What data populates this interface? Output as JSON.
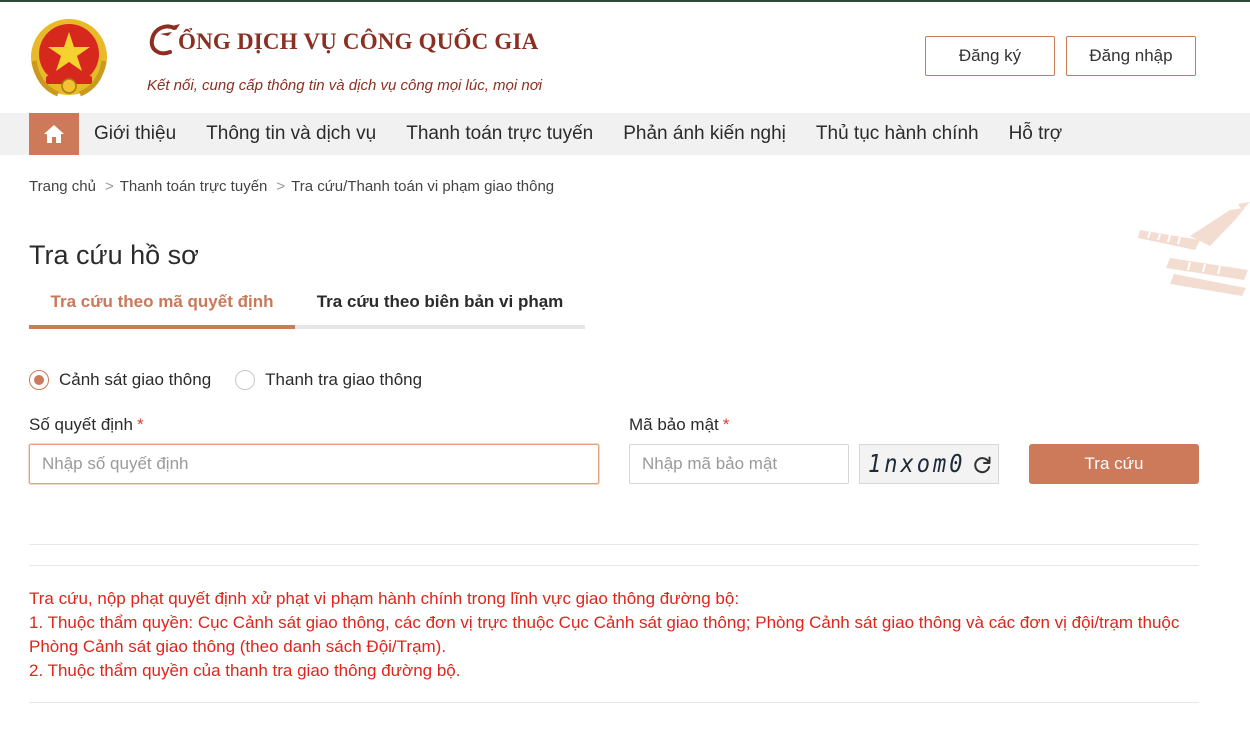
{
  "header": {
    "brand_title": "CỔNG DỊCH VỤ CÔNG QUỐC GIA",
    "brand_title_rest": "ỔNG DỊCH VỤ CÔNG QUỐC GIA",
    "brand_subtitle": "Kết nối, cung cấp thông tin và dịch vụ công mọi lúc, mọi nơi",
    "register_label": "Đăng ký",
    "login_label": "Đăng nhập"
  },
  "nav": {
    "home_icon": "home-icon",
    "items": [
      {
        "label": "Giới thiệu"
      },
      {
        "label": "Thông tin và dịch vụ"
      },
      {
        "label": "Thanh toán trực tuyến"
      },
      {
        "label": "Phản ánh kiến nghị"
      },
      {
        "label": "Thủ tục hành chính"
      },
      {
        "label": "Hỗ trợ"
      }
    ]
  },
  "breadcrumb": [
    {
      "label": "Trang chủ"
    },
    {
      "label": "Thanh toán trực tuyến"
    },
    {
      "label": "Tra cứu/Thanh toán vi phạm giao thông"
    }
  ],
  "breadcrumb_separator": ">",
  "page_title": "Tra cứu hồ sơ",
  "tabs": [
    {
      "label": "Tra cứu theo mã quyết định",
      "active": true
    },
    {
      "label": "Tra cứu theo biên bản vi phạm",
      "active": false
    }
  ],
  "radios": [
    {
      "label": "Cảnh sát giao thông",
      "checked": true
    },
    {
      "label": "Thanh tra giao thông",
      "checked": false
    }
  ],
  "form": {
    "decision_label": "Số quyết định",
    "decision_placeholder": "Nhập số quyết định",
    "decision_value": "",
    "security_label": "Mã bảo mật",
    "security_placeholder": "Nhập mã bảo mật",
    "security_value": "",
    "required_mark": "*",
    "captcha_text": "1nxom0",
    "refresh_icon": "refresh-icon",
    "search_button": "Tra cứu"
  },
  "notes": [
    "Tra cứu, nộp phạt quyết định xử phạt vi phạm hành chính trong lĩnh vực giao thông đường bộ:",
    "1. Thuộc thẩm quyền: Cục Cảnh sát giao thông, các đơn vị trực thuộc Cục Cảnh sát giao thông; Phòng Cảnh sát giao thông và các đơn vị đội/trạm thuộc Phòng Cảnh sát giao thông (theo danh sách Đội/Trạm).",
    "2. Thuộc thẩm quyền của thanh tra giao thông đường bộ."
  ],
  "colors": {
    "accent": "#cc7a5a",
    "brand": "#8a2f22",
    "notes": "#e0241c"
  }
}
